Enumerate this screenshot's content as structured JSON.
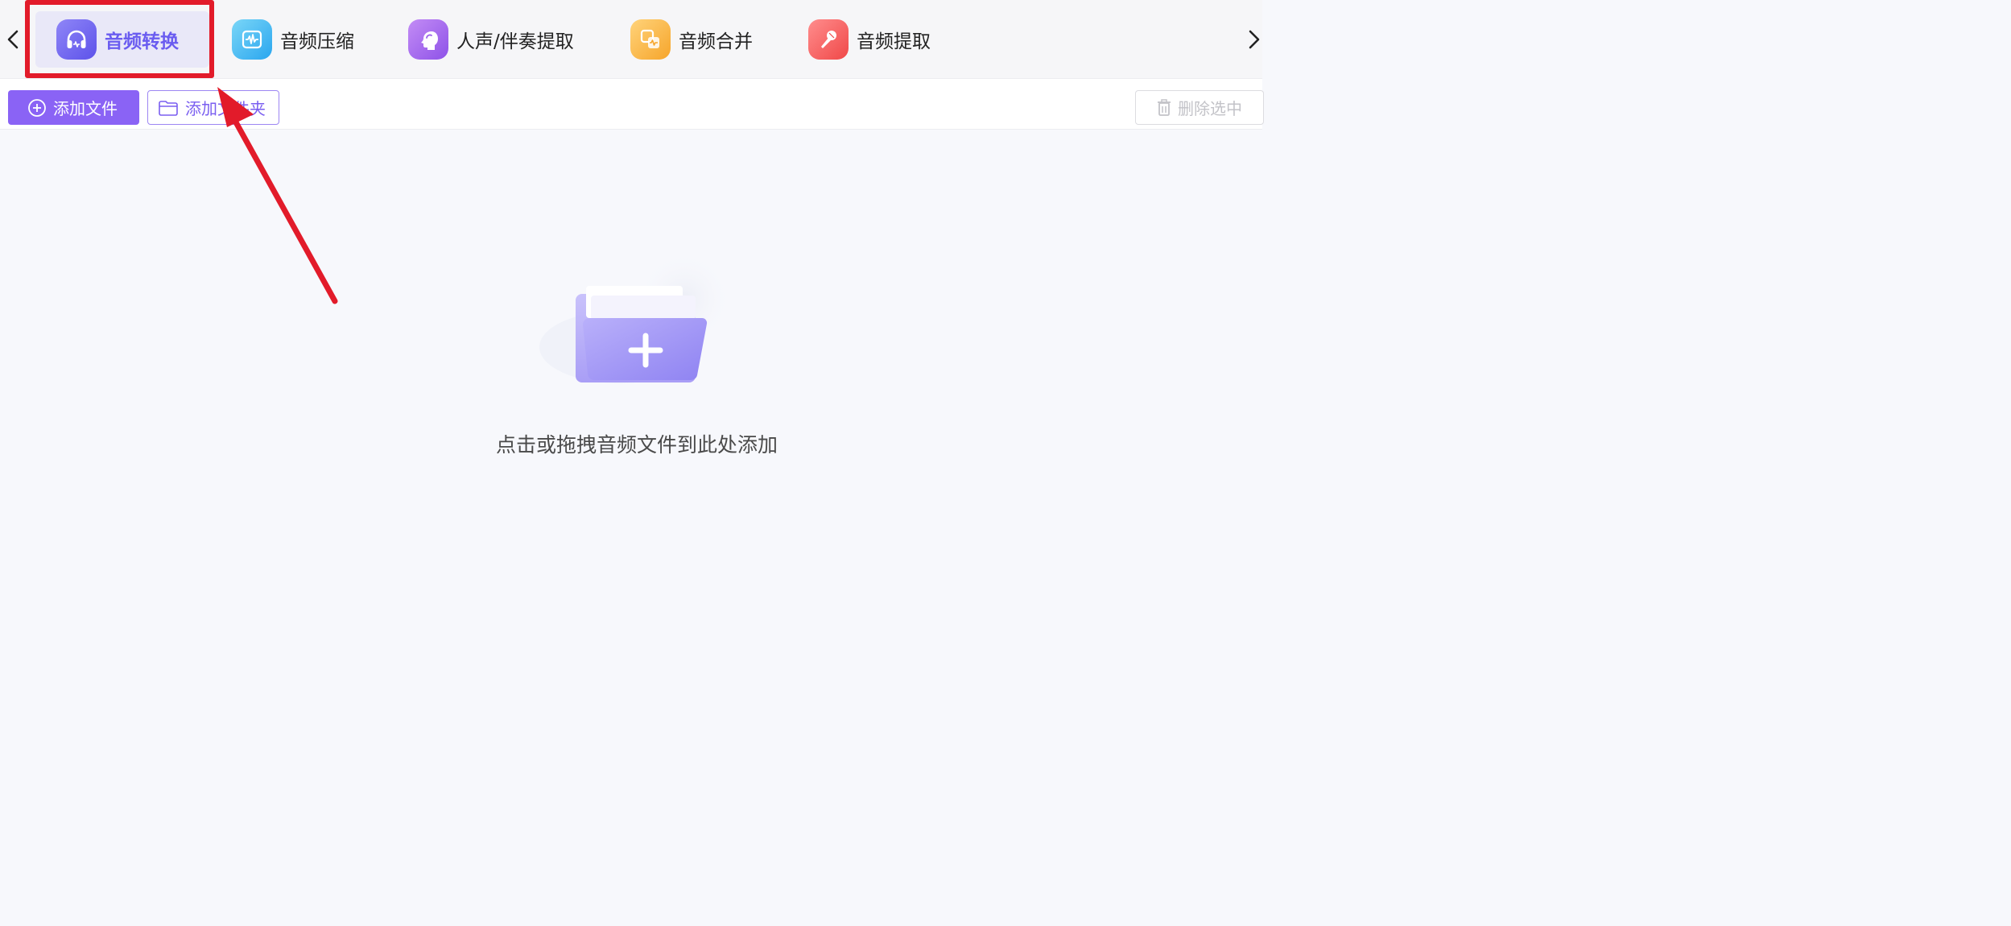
{
  "tabs": [
    {
      "id": "convert",
      "label": "音频转换",
      "icon": "headphones-icon",
      "active": true
    },
    {
      "id": "compress",
      "label": "音频压缩",
      "icon": "waveform-icon",
      "active": false
    },
    {
      "id": "vocal",
      "label": "人声/伴奏提取",
      "icon": "voice-profile-icon",
      "active": false
    },
    {
      "id": "merge",
      "label": "音频合并",
      "icon": "merge-icon",
      "active": false
    },
    {
      "id": "extract",
      "label": "音频提取",
      "icon": "microphone-icon",
      "active": false
    }
  ],
  "toolbar": {
    "add_file_label": "添加文件",
    "add_folder_label": "添加文件夹",
    "delete_selected_label": "删除选中"
  },
  "dropzone": {
    "hint": "点击或拖拽音频文件到此处添加"
  },
  "colors": {
    "accent": "#8a63f5",
    "active_tab_text": "#6a5cf0",
    "annotation_red": "#e21b2a"
  }
}
